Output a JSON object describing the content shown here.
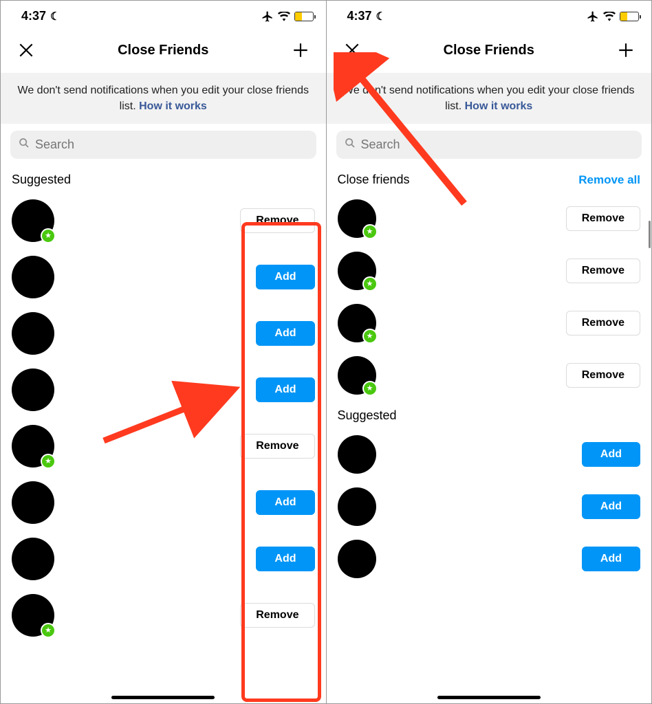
{
  "status": {
    "time": "4:37",
    "battery_pct": 40
  },
  "header": {
    "title": "Close Friends"
  },
  "banner": {
    "text": "We don't send notifications when you edit your close friends list. ",
    "link": "How it works"
  },
  "search": {
    "placeholder": "Search"
  },
  "labels": {
    "suggested": "Suggested",
    "close_friends": "Close friends",
    "remove_all": "Remove all",
    "add": "Add",
    "remove": "Remove"
  },
  "left": {
    "section": "suggested",
    "items": [
      {
        "type": "remove",
        "star": true
      },
      {
        "type": "add",
        "star": false
      },
      {
        "type": "add",
        "star": false
      },
      {
        "type": "add",
        "star": false
      },
      {
        "type": "remove",
        "star": true
      },
      {
        "type": "add",
        "star": false
      },
      {
        "type": "add",
        "star": false
      },
      {
        "type": "remove",
        "star": true
      }
    ]
  },
  "right": {
    "close": [
      {
        "star": true
      },
      {
        "star": true
      },
      {
        "star": true
      },
      {
        "star": true
      }
    ],
    "suggested": [
      {
        "star": false
      },
      {
        "star": false
      },
      {
        "star": false
      }
    ]
  }
}
